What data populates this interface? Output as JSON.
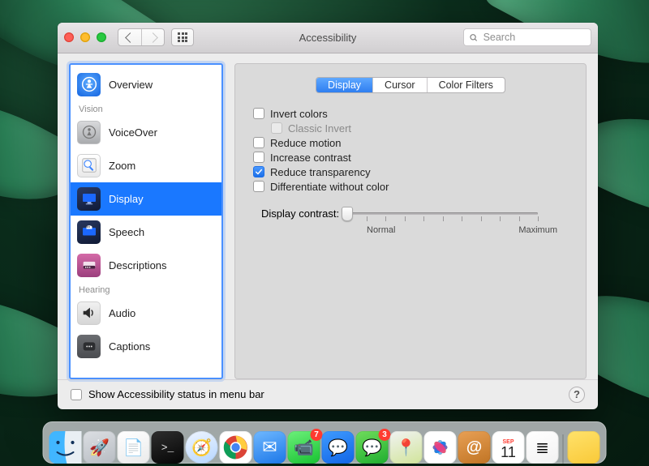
{
  "window": {
    "title": "Accessibility",
    "search_placeholder": "Search"
  },
  "sidebar": {
    "top_item": "Overview",
    "sections": [
      {
        "header": "Vision",
        "items": [
          "VoiceOver",
          "Zoom",
          "Display",
          "Speech",
          "Descriptions"
        ],
        "selected": "Display"
      },
      {
        "header": "Hearing",
        "items": [
          "Audio",
          "Captions"
        ]
      }
    ]
  },
  "tabs": {
    "items": [
      "Display",
      "Cursor",
      "Color Filters"
    ],
    "active": "Display"
  },
  "options": {
    "invert_colors": {
      "label": "Invert colors",
      "checked": false
    },
    "classic_invert": {
      "label": "Classic Invert",
      "checked": false,
      "disabled": true
    },
    "reduce_motion": {
      "label": "Reduce motion",
      "checked": false
    },
    "increase_contrast": {
      "label": "Increase contrast",
      "checked": false
    },
    "reduce_transparency": {
      "label": "Reduce transparency",
      "checked": true
    },
    "diff_without_color": {
      "label": "Differentiate without color",
      "checked": false
    }
  },
  "contrast": {
    "label": "Display contrast:",
    "min_label": "Normal",
    "max_label": "Maximum",
    "value": 0,
    "min": 0,
    "max": 100
  },
  "footer": {
    "show_status_label": "Show Accessibility status in menu bar",
    "show_status_checked": false
  },
  "dock": {
    "items": [
      {
        "name": "finder",
        "color1": "#41b6ff",
        "color2": "#1c6df4",
        "glyph": ""
      },
      {
        "name": "launchpad",
        "color1": "#dcdfe3",
        "color2": "#b7bcc2",
        "glyph": "🚀"
      },
      {
        "name": "notes-white",
        "color1": "#ffffff",
        "color2": "#eaeaea",
        "glyph": "📄"
      },
      {
        "name": "terminal",
        "color1": "#2e2e2e",
        "color2": "#050505",
        "glyph": ">_"
      },
      {
        "name": "safari",
        "color1": "#eef5ff",
        "color2": "#b6d6ff",
        "glyph": "🧭"
      },
      {
        "name": "chrome",
        "color1": "#ffffff",
        "color2": "#ffffff",
        "glyph": "🌐"
      },
      {
        "name": "mail",
        "color1": "#6fb8ff",
        "color2": "#1c77e8",
        "glyph": "✉︎"
      },
      {
        "name": "facetime",
        "color1": "#6cf07a",
        "color2": "#18c232",
        "glyph": "📹",
        "badge": "7"
      },
      {
        "name": "messenger",
        "color1": "#3f9bff",
        "color2": "#1165e6",
        "glyph": "💬"
      },
      {
        "name": "messages",
        "color1": "#6fdc5b",
        "color2": "#1fae2f",
        "glyph": "💬",
        "badge": "3"
      },
      {
        "name": "maps",
        "color1": "#f1f3f3",
        "color2": "#d1e49a",
        "glyph": "📍"
      },
      {
        "name": "photos",
        "color1": "#ffffff",
        "color2": "#ffffff",
        "glyph": "❀"
      },
      {
        "name": "contacts",
        "color1": "#e8a055",
        "color2": "#c07424",
        "glyph": "@"
      },
      {
        "name": "calendar",
        "color1": "#ffffff",
        "color2": "#ffffff",
        "glyph": "11",
        "top": "SEP"
      },
      {
        "name": "reminders",
        "color1": "#ffffff",
        "color2": "#f2f2f2",
        "glyph": "≣"
      }
    ],
    "after_separator": [
      {
        "name": "stickies",
        "color1": "#ffe26b",
        "color2": "#f9c938",
        "glyph": ""
      }
    ]
  }
}
